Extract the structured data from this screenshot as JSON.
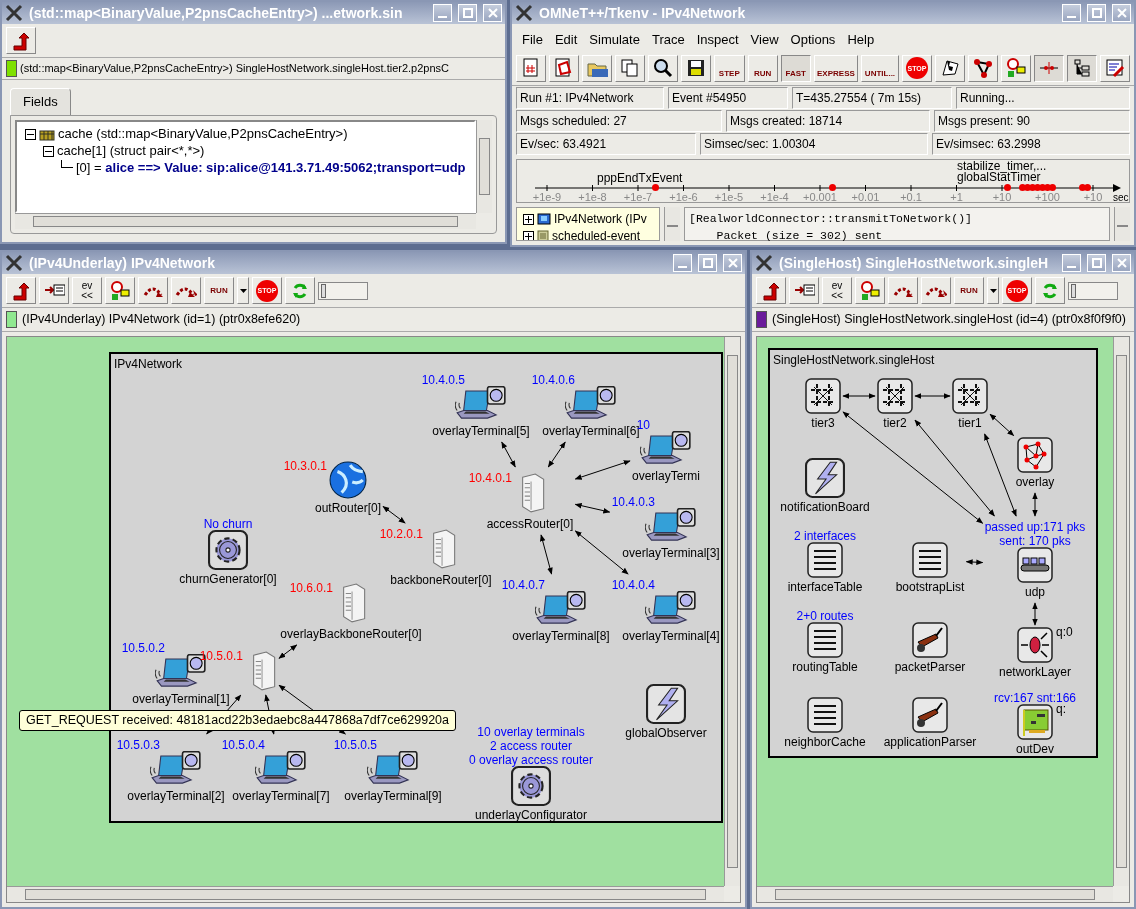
{
  "map_inspector": {
    "title": "(std::map<BinaryValue,P2pnsCacheEntry>) ...etwork.sin",
    "path": "(std::map<BinaryValue,P2pnsCacheEntry>) SingleHostNetwork.singleHost.tier2.p2pnsC",
    "tabs": [
      {
        "label": "Fields",
        "selected": true
      }
    ],
    "tree": [
      {
        "label": "cache (std::map<BinaryValue,P2pnsCacheEntry>)",
        "expanded": true,
        "children": [
          {
            "label": "cache[1] (struct pair<*,*>)",
            "expanded": true,
            "children": [
              {
                "label": "[0] =",
                "value": "alice ==> Value: sip:alice@141.3.71.49:5062;transport=udp"
              }
            ]
          }
        ]
      }
    ]
  },
  "main_window": {
    "title": "OMNeT++/Tkenv - IPv4Network",
    "menu": [
      "File",
      "Edit",
      "Simulate",
      "Trace",
      "Inspect",
      "View",
      "Options",
      "Help"
    ],
    "toolbar": [
      {
        "kind": "icon",
        "pressed": false
      },
      {
        "kind": "icon",
        "pressed": false
      },
      {
        "kind": "icon",
        "pressed": false
      },
      {
        "kind": "icon",
        "pressed": false
      },
      {
        "kind": "icon",
        "pressed": false
      },
      {
        "kind": "icon",
        "pressed": false
      },
      {
        "kind": "labeled",
        "label": "STEP",
        "pressed": false
      },
      {
        "kind": "labeled",
        "label": "RUN",
        "pressed": false
      },
      {
        "kind": "labeled",
        "label": "FAST",
        "pressed": true
      },
      {
        "kind": "labeled",
        "label": "EXPRESS",
        "pressed": false
      },
      {
        "kind": "labeled",
        "label": "UNTIL...",
        "pressed": false
      },
      {
        "kind": "stop",
        "label": "STOP",
        "pressed": false
      },
      {
        "kind": "icon",
        "pressed": false
      },
      {
        "kind": "icon",
        "pressed": false
      },
      {
        "kind": "icon",
        "pressed": false
      },
      {
        "kind": "icon",
        "pressed": true
      },
      {
        "kind": "icon",
        "pressed": true
      },
      {
        "kind": "icon",
        "pressed": false
      }
    ],
    "status_rows": [
      [
        "Run #1: IPv4Network",
        "Event #54950",
        "T=435.27554 ( 7m 15s)",
        "Running..."
      ],
      [
        "Msgs scheduled: 27",
        "Msgs created: 18714",
        "Msgs present: 90"
      ],
      [
        "Ev/sec: 63.4921",
        "Simsec/sec: 1.00304",
        "Ev/simsec: 63.2998"
      ]
    ],
    "timeline": {
      "ticks": [
        "+1e-9",
        "+1e-8",
        "+1e-7",
        "+1e-6",
        "+1e-5",
        "+1e-4",
        "+0.001",
        "+0.01",
        "+0.1",
        "+1",
        "+10",
        "+100",
        "+10"
      ],
      "unit": "sec",
      "events": [
        "pppEndTxEvent",
        "stabilize_timer,...",
        "globalStatTimer"
      ]
    },
    "object_tree": [
      {
        "label": "IPv4Network (IPv",
        "expanded": false
      },
      {
        "label": "scheduled-event",
        "expanded": false
      }
    ],
    "log": [
      "[RealworldConnector::transmitToNetwork()]",
      "    Packet (size = 302) sent"
    ]
  },
  "network_inspector": {
    "title": "(IPv4Underlay) IPv4Network",
    "toolbar": [
      {
        "kind": "icon"
      },
      {
        "kind": "icon"
      },
      {
        "kind": "labeled",
        "label": "ev <<"
      },
      {
        "kind": "icon"
      },
      {
        "kind": "icon"
      },
      {
        "kind": "icon"
      },
      {
        "kind": "labeled",
        "label": "RUN"
      },
      {
        "kind": "dropdown"
      },
      {
        "kind": "stop",
        "label": "STOP"
      },
      {
        "kind": "icon"
      }
    ],
    "speed": {
      "level": 0.05
    },
    "path": "(IPv4Underlay) IPv4Network  (id=1)  (ptr0x8efe620)",
    "module": "IPv4Network",
    "nodes": [
      {
        "kind": "laptop",
        "name": "overlayTerminal[5]",
        "address": "10.4.0.5"
      },
      {
        "kind": "laptop",
        "name": "overlayTerminal[6]",
        "address": "10.4.0.6"
      },
      {
        "kind": "laptop",
        "name": "overlayTermi",
        "address": "10"
      },
      {
        "kind": "globe",
        "name": "outRouter[0]",
        "address": "10.3.0.1"
      },
      {
        "kind": "server",
        "name": "accessRouter[0]",
        "address": "10.4.0.1"
      },
      {
        "kind": "laptop",
        "name": "overlayTerminal[3]",
        "address": "10.4.0.3"
      },
      {
        "kind": "gear",
        "name": "churnGenerator[0]",
        "status": [
          "No churn"
        ]
      },
      {
        "kind": "server",
        "name": "backboneRouter[0]",
        "address": "10.2.0.1"
      },
      {
        "kind": "server",
        "name": "overlayBackboneRouter[0]",
        "address": "10.6.0.1"
      },
      {
        "kind": "laptop",
        "name": "overlayTerminal[8]",
        "address": "10.4.0.7"
      },
      {
        "kind": "laptop",
        "name": "overlayTerminal[4]",
        "address": "10.4.0.4"
      },
      {
        "kind": "laptop",
        "name": "overlayTerminal[1]",
        "address": "10.5.0.2"
      },
      {
        "kind": "server",
        "address": "10.5.0.1"
      },
      {
        "kind": "lightning",
        "name": "globalObserver"
      },
      {
        "kind": "laptop",
        "name": "overlayTerminal[2]",
        "address": "10.5.0.3"
      },
      {
        "kind": "laptop",
        "name": "overlayTerminal[7]",
        "address": "10.5.0.4"
      },
      {
        "kind": "laptop",
        "name": "overlayTerminal[9]",
        "address": "10.5.0.5"
      },
      {
        "kind": "gear",
        "name": "underlayConfigurator",
        "status": [
          "10 overlay terminals",
          "2 access router",
          "0 overlay access router"
        ]
      }
    ],
    "tooltip": "GET_REQUEST received: 48181acd22b3edaebc8a447868a7df7ce629920a"
  },
  "host_inspector": {
    "title": "(SingleHost) SingleHostNetwork.singleH",
    "toolbar": [
      {
        "kind": "icon"
      },
      {
        "kind": "icon"
      },
      {
        "kind": "labeled",
        "label": "ev <<"
      },
      {
        "kind": "icon"
      },
      {
        "kind": "icon"
      },
      {
        "kind": "icon"
      },
      {
        "kind": "labeled",
        "label": "RUN"
      },
      {
        "kind": "dropdown"
      },
      {
        "kind": "stop",
        "label": "STOP"
      },
      {
        "kind": "icon"
      }
    ],
    "speed": {
      "level": 0.05
    },
    "path": "(SingleHost) SingleHostNetwork.singleHost  (id=4)  (ptr0x8f0f9f0)",
    "module": "SingleHostNetwork.singleHost",
    "nodes": [
      {
        "kind": "puzzle",
        "name": "tier3"
      },
      {
        "kind": "puzzle",
        "name": "tier2"
      },
      {
        "kind": "puzzle",
        "name": "tier1"
      },
      {
        "kind": "graph",
        "name": "overlay"
      },
      {
        "kind": "lightning",
        "name": "notificationBoard"
      },
      {
        "kind": "list",
        "name": "interfaceTable",
        "status": [
          "2 interfaces"
        ]
      },
      {
        "kind": "list",
        "name": "bootstrapList"
      },
      {
        "kind": "conveyor",
        "name": "udp",
        "status": [
          "passed up:171 pks",
          "sent: 170 pks"
        ]
      },
      {
        "kind": "list",
        "name": "routingTable",
        "status": [
          "2+0 routes"
        ]
      },
      {
        "kind": "barrow",
        "name": "packetParser"
      },
      {
        "kind": "switch",
        "name": "networkLayer",
        "queue": "q:0"
      },
      {
        "kind": "list",
        "name": "neighborCache"
      },
      {
        "kind": "barrow",
        "name": "applicationParser"
      },
      {
        "kind": "card",
        "name": "outDev",
        "status": [
          "rcv:167 snt:166"
        ],
        "queue": "q:"
      }
    ]
  }
}
